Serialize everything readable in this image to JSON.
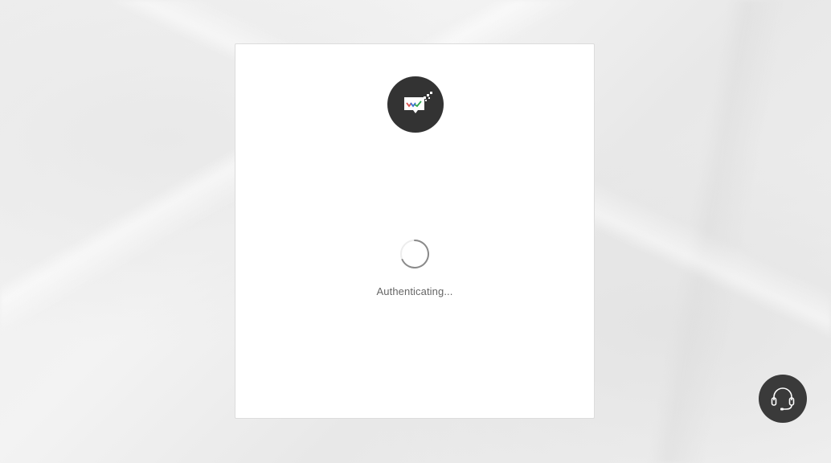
{
  "auth": {
    "status_text": "Authenticating..."
  },
  "logo": {
    "icon": "chat-checkmark-logo-icon",
    "background_color": "#333333"
  },
  "spinner": {
    "icon": "loading-spinner-icon"
  },
  "support_button": {
    "icon": "headset-icon",
    "background_color": "#3a3a3a"
  }
}
